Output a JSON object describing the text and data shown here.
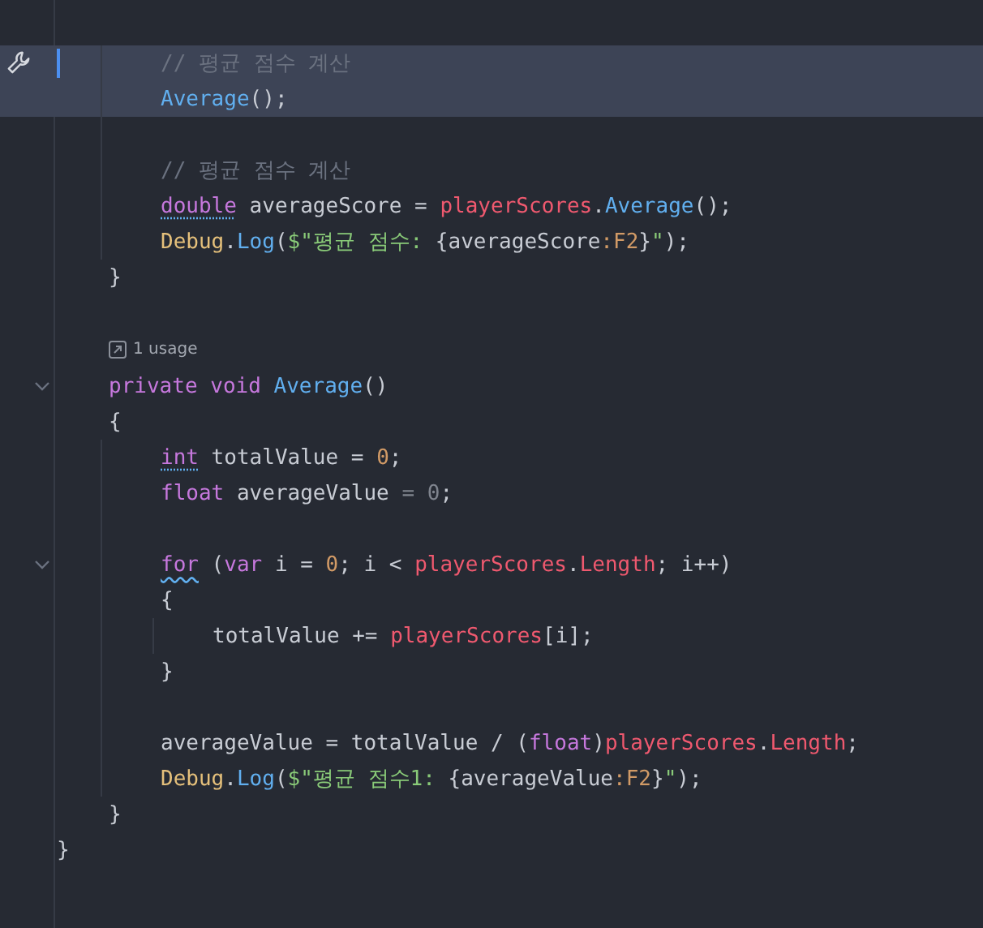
{
  "editor": {
    "lines": [
      {
        "kind": "block",
        "children": [
          {
            "kind": "block",
            "children": [
              {
                "kind": "code",
                "highlighted": true,
                "caret": true,
                "wrench": true,
                "tokens": [
                  {
                    "t": "// 평균 점수 계산",
                    "kind": "comment"
                  }
                ]
              },
              {
                "kind": "code",
                "highlighted": true,
                "tokens": [
                  {
                    "t": "Average",
                    "kind": "function"
                  },
                  {
                    "t": "();",
                    "kind": "plain"
                  }
                ]
              },
              {
                "kind": "blank"
              },
              {
                "kind": "code",
                "highlighted": false,
                "tokens": [
                  {
                    "t": "// 평균 점수 계산",
                    "kind": "comment"
                  }
                ]
              },
              {
                "kind": "code",
                "highlighted": false,
                "tokens": [
                  {
                    "t": "double",
                    "kind": "keyword_hint"
                  },
                  {
                    "t": " averageScore = ",
                    "kind": "plain"
                  },
                  {
                    "t": "playerScores",
                    "kind": "field"
                  },
                  {
                    "t": ".",
                    "kind": "plain"
                  },
                  {
                    "t": "Average",
                    "kind": "function"
                  },
                  {
                    "t": "();",
                    "kind": "plain"
                  }
                ]
              },
              {
                "kind": "code",
                "highlighted": false,
                "tokens": [
                  {
                    "t": "Debug",
                    "kind": "type"
                  },
                  {
                    "t": ".",
                    "kind": "plain"
                  },
                  {
                    "t": "Log",
                    "kind": "function"
                  },
                  {
                    "t": "(",
                    "kind": "plain"
                  },
                  {
                    "t": "$\"평균 점수: ",
                    "kind": "string"
                  },
                  {
                    "t": "{averageScore",
                    "kind": "plain"
                  },
                  {
                    "t": ":F2",
                    "kind": "format"
                  },
                  {
                    "t": "}",
                    "kind": "plain"
                  },
                  {
                    "t": "\"",
                    "kind": "string"
                  },
                  {
                    "t": ");",
                    "kind": "plain"
                  }
                ]
              }
            ]
          },
          {
            "kind": "code",
            "highlighted": false,
            "tokens": [
              {
                "t": "}",
                "kind": "plain"
              }
            ]
          },
          {
            "kind": "blank"
          },
          {
            "kind": "hint",
            "text": "1 usage"
          },
          {
            "kind": "code",
            "highlighted": false,
            "fold": true,
            "tokens": [
              {
                "t": "private",
                "kind": "keyword"
              },
              {
                "t": " void",
                "kind": "keyword"
              },
              {
                "t": " Average",
                "kind": "function"
              },
              {
                "t": "()",
                "kind": "plain"
              }
            ]
          },
          {
            "kind": "code",
            "highlighted": false,
            "tokens": [
              {
                "t": "{",
                "kind": "plain"
              }
            ]
          },
          {
            "kind": "block",
            "children": [
              {
                "kind": "code",
                "highlighted": false,
                "tokens": [
                  {
                    "t": "int",
                    "kind": "keyword_hint"
                  },
                  {
                    "t": " totalValue = ",
                    "kind": "plain"
                  },
                  {
                    "t": "0",
                    "kind": "number"
                  },
                  {
                    "t": ";",
                    "kind": "plain"
                  }
                ]
              },
              {
                "kind": "code",
                "highlighted": false,
                "tokens": [
                  {
                    "t": "float",
                    "kind": "keyword"
                  },
                  {
                    "t": " averageValue ",
                    "kind": "plain"
                  },
                  {
                    "t": "= 0",
                    "kind": "unused"
                  },
                  {
                    "t": ";",
                    "kind": "plain"
                  }
                ]
              },
              {
                "kind": "blank"
              },
              {
                "kind": "code",
                "highlighted": false,
                "fold": true,
                "tokens": [
                  {
                    "t": "for",
                    "kind": "keyword_warning"
                  },
                  {
                    "t": " (",
                    "kind": "plain"
                  },
                  {
                    "t": "var",
                    "kind": "keyword"
                  },
                  {
                    "t": " i = ",
                    "kind": "plain"
                  },
                  {
                    "t": "0",
                    "kind": "number"
                  },
                  {
                    "t": "; i < ",
                    "kind": "plain"
                  },
                  {
                    "t": "playerScores",
                    "kind": "field"
                  },
                  {
                    "t": ".",
                    "kind": "plain"
                  },
                  {
                    "t": "Length",
                    "kind": "field"
                  },
                  {
                    "t": "; i++)",
                    "kind": "plain"
                  }
                ]
              },
              {
                "kind": "code",
                "highlighted": false,
                "tokens": [
                  {
                    "t": "{",
                    "kind": "plain"
                  }
                ]
              },
              {
                "kind": "block",
                "children": [
                  {
                    "kind": "code",
                    "highlighted": false,
                    "tokens": [
                      {
                        "t": "totalValue += ",
                        "kind": "plain"
                      },
                      {
                        "t": "playerScores",
                        "kind": "field"
                      },
                      {
                        "t": "[i];",
                        "kind": "plain"
                      }
                    ]
                  }
                ]
              },
              {
                "kind": "code",
                "highlighted": false,
                "tokens": [
                  {
                    "t": "}",
                    "kind": "plain"
                  }
                ]
              },
              {
                "kind": "blank"
              },
              {
                "kind": "code",
                "highlighted": false,
                "tokens": [
                  {
                    "t": "averageValue = totalValue / (",
                    "kind": "plain"
                  },
                  {
                    "t": "float",
                    "kind": "keyword"
                  },
                  {
                    "t": ")",
                    "kind": "plain"
                  },
                  {
                    "t": "playerScores",
                    "kind": "field"
                  },
                  {
                    "t": ".",
                    "kind": "plain"
                  },
                  {
                    "t": "Length",
                    "kind": "field"
                  },
                  {
                    "t": ";",
                    "kind": "plain"
                  }
                ]
              },
              {
                "kind": "code",
                "highlighted": false,
                "tokens": [
                  {
                    "t": "Debug",
                    "kind": "type"
                  },
                  {
                    "t": ".",
                    "kind": "plain"
                  },
                  {
                    "t": "Log",
                    "kind": "function"
                  },
                  {
                    "t": "(",
                    "kind": "plain"
                  },
                  {
                    "t": "$\"평균 점수1: ",
                    "kind": "string"
                  },
                  {
                    "t": "{averageValue",
                    "kind": "plain"
                  },
                  {
                    "t": ":F2",
                    "kind": "format"
                  },
                  {
                    "t": "}",
                    "kind": "plain"
                  },
                  {
                    "t": "\"",
                    "kind": "string"
                  },
                  {
                    "t": ");",
                    "kind": "plain"
                  }
                ]
              }
            ]
          },
          {
            "kind": "code",
            "highlighted": false,
            "tokens": [
              {
                "t": "}",
                "kind": "plain"
              }
            ]
          }
        ]
      },
      {
        "kind": "code",
        "highlighted": false,
        "tokens": [
          {
            "t": "}",
            "kind": "plain"
          }
        ]
      }
    ]
  }
}
